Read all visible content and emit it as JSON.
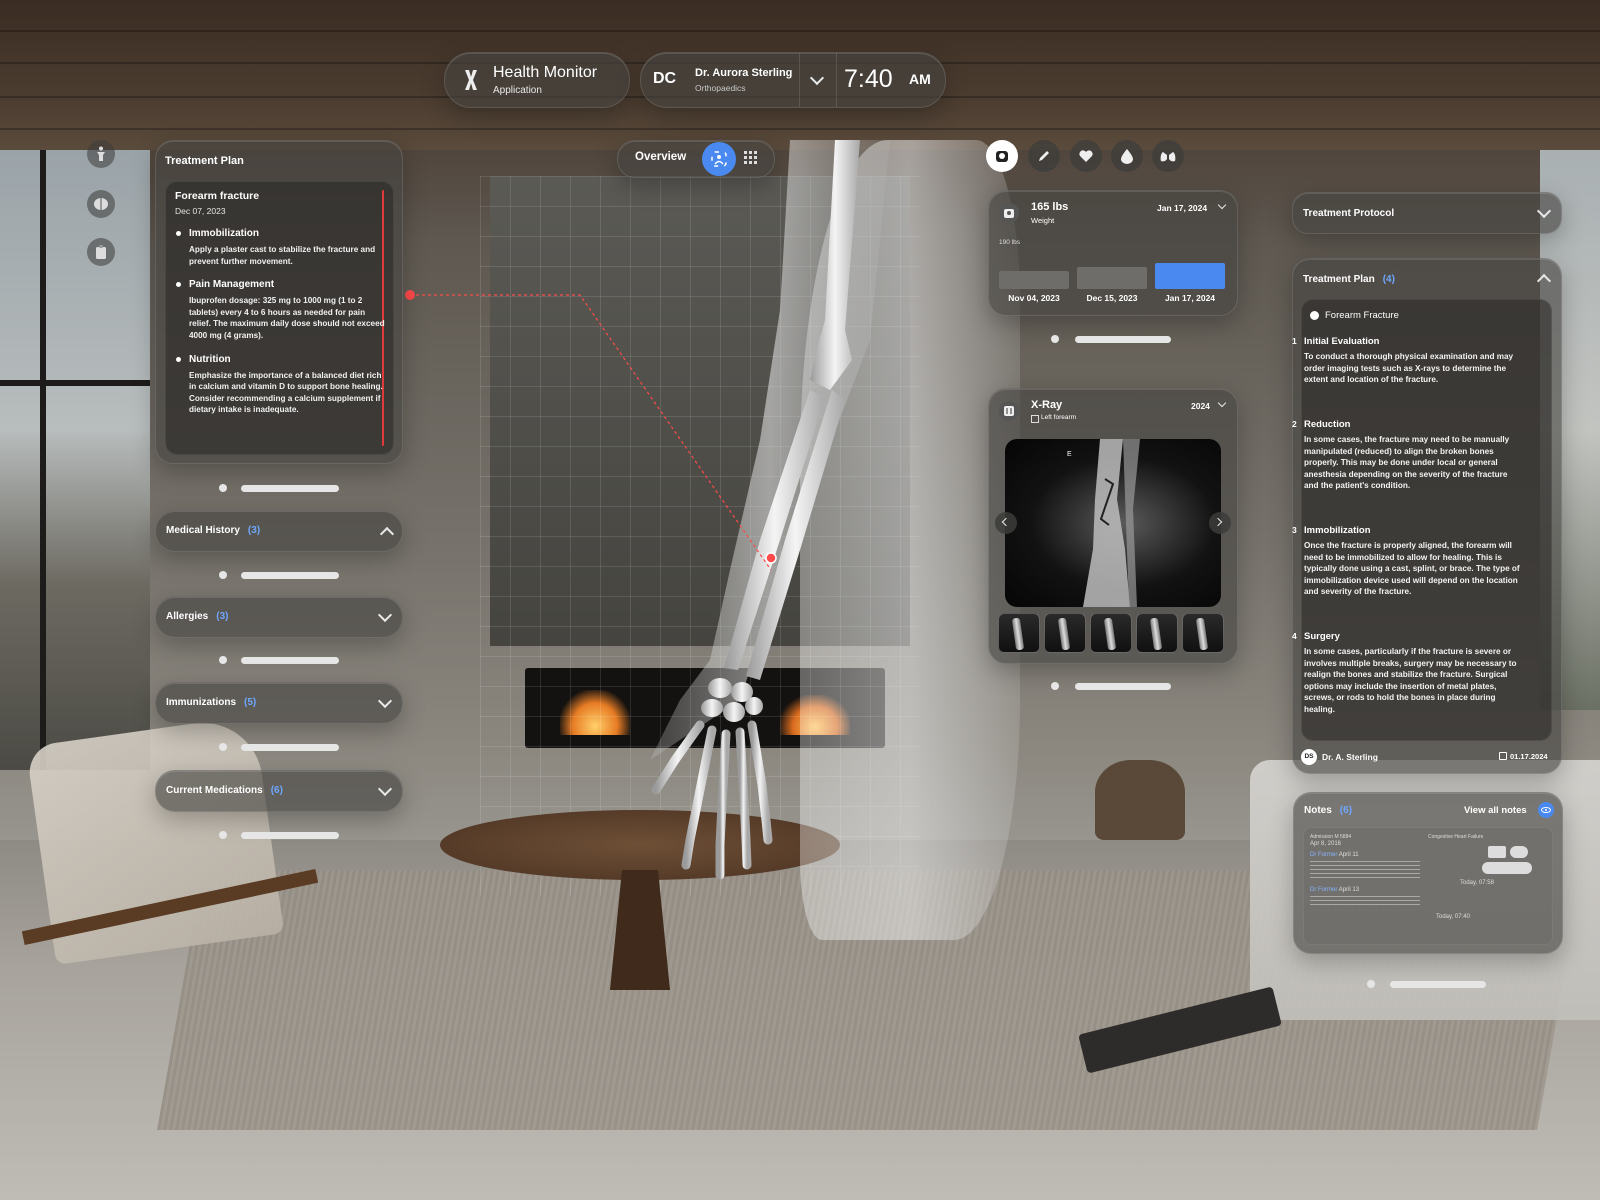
{
  "header": {
    "app_name": "Health Monitor",
    "app_subtitle": "Application",
    "doctor_initials": "DC",
    "doctor_name": "Dr. Aurora Sterling",
    "doctor_specialty": "Orthopaedics",
    "time": "7:40",
    "ampm": "AM"
  },
  "view_switcher": {
    "overview_label": "Overview",
    "anatomy_icon": "anatomy-scan-icon",
    "grid_icon": "grid-icon"
  },
  "side_rail": {
    "icons": [
      "body-pose-icon",
      "brain-icon",
      "clipboard-icon"
    ]
  },
  "metric_toolbar": {
    "icons": [
      "weight-scale-icon",
      "pen-icon",
      "heart-icon",
      "drop-icon",
      "lungs-icon"
    ]
  },
  "treatment_plan_left": {
    "title": "Treatment Plan",
    "case_title": "Forearm fracture",
    "case_date": "Dec 07, 2023",
    "items": [
      {
        "heading": "Immobilization",
        "text": "Apply a plaster cast to stabilize the fracture and prevent further movement."
      },
      {
        "heading": "Pain Management",
        "text": "Ibuprofen dosage: 325 mg to 1000 mg (1 to 2 tablets) every 4 to 6 hours as needed for pain relief. The maximum daily dose should not exceed 4000 mg (4 grams)."
      },
      {
        "heading": "Nutrition",
        "text": "Emphasize the importance of a balanced diet rich in calcium and vitamin D to support bone healing. Consider recommending a calcium supplement if dietary intake is inadequate."
      }
    ]
  },
  "accordions": [
    {
      "label": "Medical History",
      "count": "(3)",
      "state": "expanded"
    },
    {
      "label": "Allergies",
      "count": "(3)",
      "state": "collapsed"
    },
    {
      "label": "Immunizations",
      "count": "(5)",
      "state": "collapsed"
    },
    {
      "label": "Current Medications",
      "count": "(6)",
      "state": "collapsed"
    }
  ],
  "weight_card": {
    "value": "165 lbs",
    "label": "Weight",
    "date": "Jan 17, 2024",
    "axis_label": "190 lbs",
    "bars": [
      {
        "label": "Nov 04, 2023",
        "value": 0.45,
        "color": "#6f6d69"
      },
      {
        "label": "Dec 15, 2023",
        "value": 0.55,
        "color": "#6f6d69"
      },
      {
        "label": "Jan 17, 2024",
        "value": 0.65,
        "color": "#4a8af0"
      }
    ]
  },
  "xray_card": {
    "title": "X-Ray",
    "subtitle": "Left forearm",
    "year": "2024",
    "marker": "E",
    "thumbnails": 5
  },
  "treatment_protocol": {
    "title": "Treatment Protocol"
  },
  "treatment_plan_right": {
    "title": "Treatment Plan",
    "count": "(4)",
    "case_title": "Forearm Fracture",
    "steps": [
      {
        "num": "1",
        "heading": "Initial Evaluation",
        "text": "To conduct a thorough physical examination and may order imaging tests such as X-rays to determine the extent and location of the fracture."
      },
      {
        "num": "2",
        "heading": "Reduction",
        "text": "In some cases, the fracture may need to be manually manipulated (reduced) to align the broken bones properly. This may be done under local or general anesthesia depending on the severity of the fracture and the patient's condition."
      },
      {
        "num": "3",
        "heading": "Immobilization",
        "text": "Once the fracture is properly aligned, the forearm will need to be immobilized to allow for healing. This is typically done using a cast, splint, or brace. The type of immobilization device used will depend on the location and severity of the fracture."
      },
      {
        "num": "4",
        "heading": "Surgery",
        "text": "In some cases, particularly if the fracture is severe or involves multiple breaks, surgery may be necessary to realign the bones and stabilize the fracture. Surgical options may include the insertion of metal plates, screws, or rods to hold the bones in place during healing."
      }
    ],
    "author_initials": "DS",
    "author": "Dr. A. Sterling",
    "date": "01.17.2024"
  },
  "notes": {
    "title": "Notes",
    "count": "(6)",
    "view_all": "View all notes",
    "left_entries": [
      {
        "label": "Admission M 5884",
        "date": "Apr 8, 2016"
      },
      {
        "label": "Dr Former",
        "date": "April 11"
      },
      {
        "label": "Dr Former",
        "date": "April 13"
      }
    ],
    "right_title": "Congestive Heart Failure",
    "right_entries": [
      "Today, 07:58",
      "Today, 07:40"
    ]
  }
}
